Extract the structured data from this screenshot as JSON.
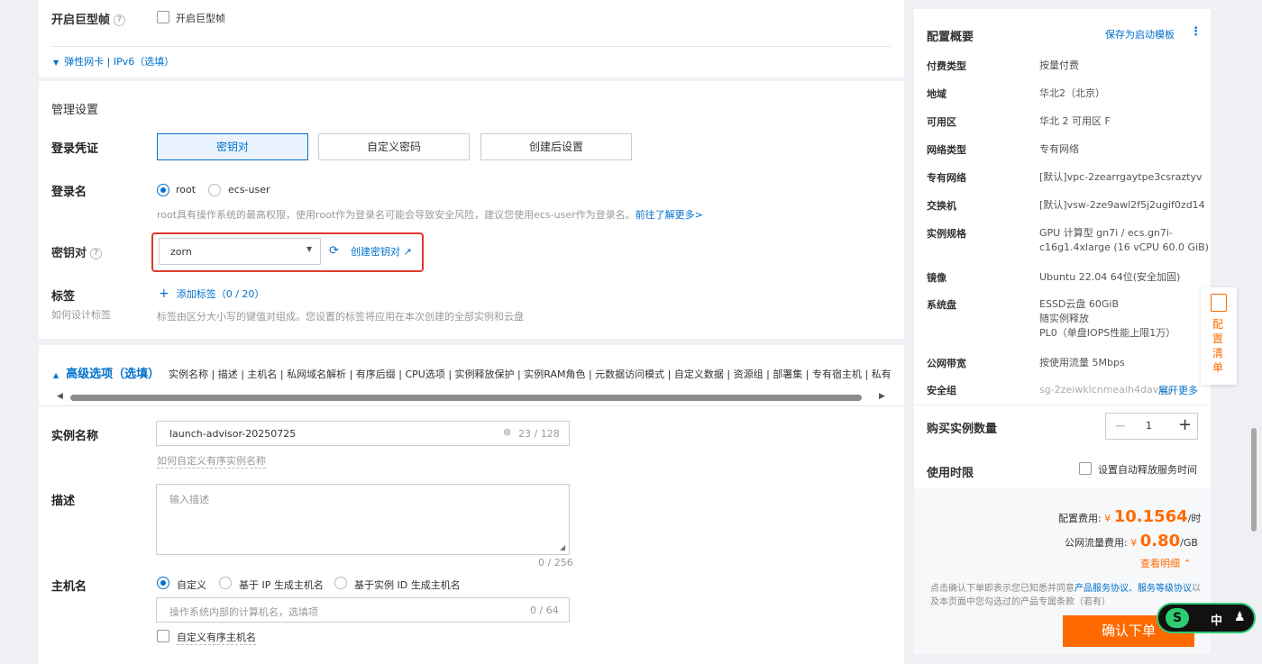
{
  "top": {
    "jumbo_frame_label": "开启巨型帧",
    "jumbo_frame_checkbox_label": "开启巨型帧",
    "eni_ipv6_toggle": "弹性网卡 | IPv6（选填）"
  },
  "manage": {
    "section_title": "管理设置",
    "login_credential_label": "登录凭证",
    "credential_options": [
      "密钥对",
      "自定义密码",
      "创建后设置"
    ],
    "login_name_label": "登录名",
    "login_name_options": [
      "root",
      "ecs-user"
    ],
    "login_name_hint": "root具有操作系统的最高权限，使用root作为登录名可能会导致安全风险，建议您使用ecs-user作为登录名。",
    "login_name_learn_more": "前往了解更多>",
    "keypair_label": "密钥对",
    "keypair_value": "zorn",
    "create_keypair_link": "创建密钥对",
    "tags_label": "标签",
    "tags_hint_link": "如何设计标签",
    "add_tag": "添加标签（0 / 20）",
    "tags_desc": "标签由区分大小写的键值对组成。您设置的标签将应用在本次创建的全部实例和云盘"
  },
  "advanced": {
    "title": "高级选项（选填）",
    "items": "实例名称 | 描述 | 主机名 | 私网域名解析 | 有序后缀 | CPU选项 | 实例释放保护 | 实例RAM角色 | 元数据访问模式 | 自定义数据 | 资源组 | 部署集 | 专有宿主机 | 私有池关",
    "instance_name_label": "实例名称",
    "instance_name_value": "launch-advisor-20250725",
    "instance_name_count": "23 / 128",
    "instance_name_hint": "如何自定义有序实例名称",
    "description_label": "描述",
    "description_placeholder": "输入描述",
    "description_count": "0 / 256",
    "hostname_label": "主机名",
    "hostname_options": [
      "自定义",
      "基于 IP 生成主机名",
      "基于实例 ID 生成主机名"
    ],
    "hostname_placeholder": "操作系统内部的计算机名，选填项",
    "hostname_count": "0 / 64",
    "ordered_hostname": "自定义有序主机名"
  },
  "summary": {
    "title": "配置概要",
    "save_template": "保存为启动模板",
    "rows": [
      {
        "k": "付费类型",
        "v": [
          "按量付费"
        ]
      },
      {
        "k": "地域",
        "v": [
          "华北2（北京）"
        ]
      },
      {
        "k": "可用区",
        "v": [
          "华北 2 可用区 F"
        ]
      },
      {
        "k": "网络类型",
        "v": [
          "专有网络"
        ]
      },
      {
        "k": "专有网络",
        "v": [
          "[默认]vpc-2zearrgaytpe3csraztyv"
        ]
      },
      {
        "k": "交换机",
        "v": [
          "[默认]vsw-2ze9awl2f5j2ugif0zd14"
        ]
      },
      {
        "k": "实例规格",
        "v": [
          "GPU 计算型 gn7i / ecs.gn7i-",
          "c16g1.4xlarge (16 vCPU 60.0 GiB)"
        ]
      },
      {
        "k": "镜像",
        "v": [
          "Ubuntu 22.04 64位(安全加固)"
        ]
      },
      {
        "k": "系统盘",
        "v": [
          "ESSD云盘 60GiB",
          "随实例释放",
          "PL0（单盘IOPS性能上限1万）"
        ]
      },
      {
        "k": "公网带宽",
        "v": [
          "按使用流量 5Mbps"
        ]
      },
      {
        "k": "安全组",
        "v": [
          "sg-2zeiwklcnmeaih4davxg"
        ]
      }
    ],
    "expand_more": "展开更多",
    "qty_label": "购买实例数量",
    "qty_value": "1",
    "duration_label": "使用时限",
    "auto_release": "设置自动释放服务时间",
    "config_fee_label": "配置费用:",
    "config_fee_value": "10.1564",
    "config_fee_unit": "/时",
    "traffic_fee_label": "公网流量费用:",
    "traffic_fee_value": "0.80",
    "traffic_fee_unit": "/GB",
    "currency": "¥",
    "view_detail": "查看明细",
    "agreement_1": "点击确认下单即表示您已知悉并同意",
    "agreement_link1": "产品服务协议、服务等",
    "agreement_link2": "级协议",
    "agreement_2": "以及本页面中您勾选过的产品专属条款（若有）",
    "confirm": "确认下单",
    "float_tab": [
      "配",
      "置",
      "清",
      "单"
    ]
  },
  "ime": {
    "label": "中"
  }
}
